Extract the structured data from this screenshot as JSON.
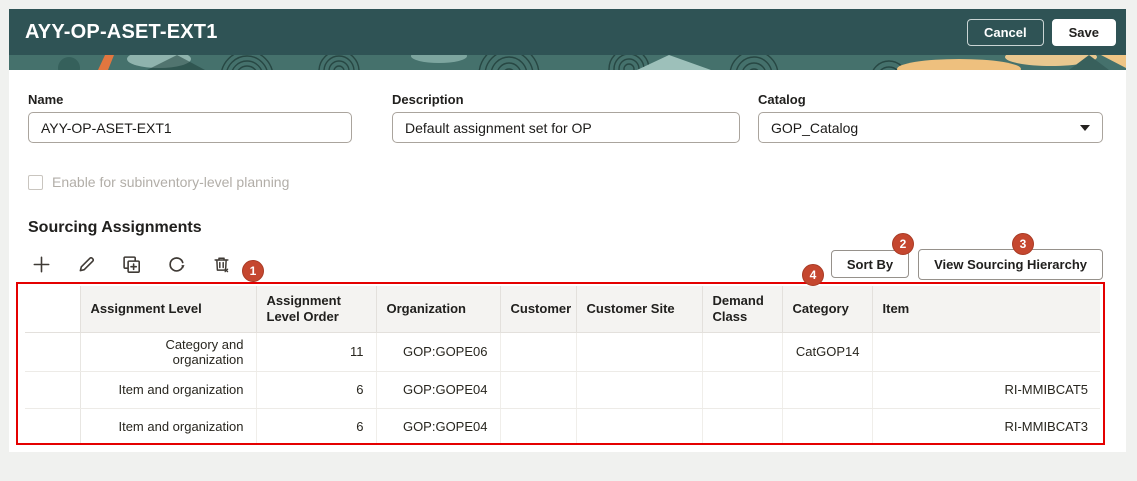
{
  "header": {
    "title": "AYY-OP-ASET-EXT1",
    "cancel_label": "Cancel",
    "save_label": "Save"
  },
  "form": {
    "name_label": "Name",
    "name_value": "AYY-OP-ASET-EXT1",
    "description_label": "Description",
    "description_value": "Default assignment set for OP",
    "catalog_label": "Catalog",
    "catalog_value": "GOP_Catalog",
    "subinventory_checkbox_label": "Enable for subinventory-level planning",
    "subinventory_checkbox_checked": false
  },
  "sourcing": {
    "heading": "Sourcing Assignments",
    "toolbar_icons": [
      "add",
      "edit",
      "duplicate",
      "refresh",
      "delete"
    ],
    "sort_by_label": "Sort By",
    "view_hierarchy_label": "View Sourcing Hierarchy"
  },
  "annotations": {
    "badges": [
      {
        "label": "1"
      },
      {
        "label": "2"
      },
      {
        "label": "3"
      },
      {
        "label": "4"
      }
    ]
  },
  "table": {
    "columns": [
      "",
      "Assignment Level",
      "Assignment Level Order",
      "Organization",
      "Customer",
      "Customer Site",
      "Demand Class",
      "Category",
      "Item"
    ],
    "rows": [
      [
        "",
        "Category and organization",
        "11",
        "GOP:GOPE06",
        "",
        "",
        "",
        "CatGOP14",
        ""
      ],
      [
        "",
        "Item and organization",
        "6",
        "GOP:GOPE04",
        "",
        "",
        "",
        "",
        "RI-MMIBCAT5"
      ],
      [
        "",
        "Item and organization",
        "6",
        "GOP:GOPE04",
        "",
        "",
        "",
        "",
        "RI-MMIBCAT3"
      ]
    ]
  },
  "colors": {
    "header_teal": "#2f5355",
    "badge_red": "#c5472f",
    "annotation_red": "#e40000"
  }
}
